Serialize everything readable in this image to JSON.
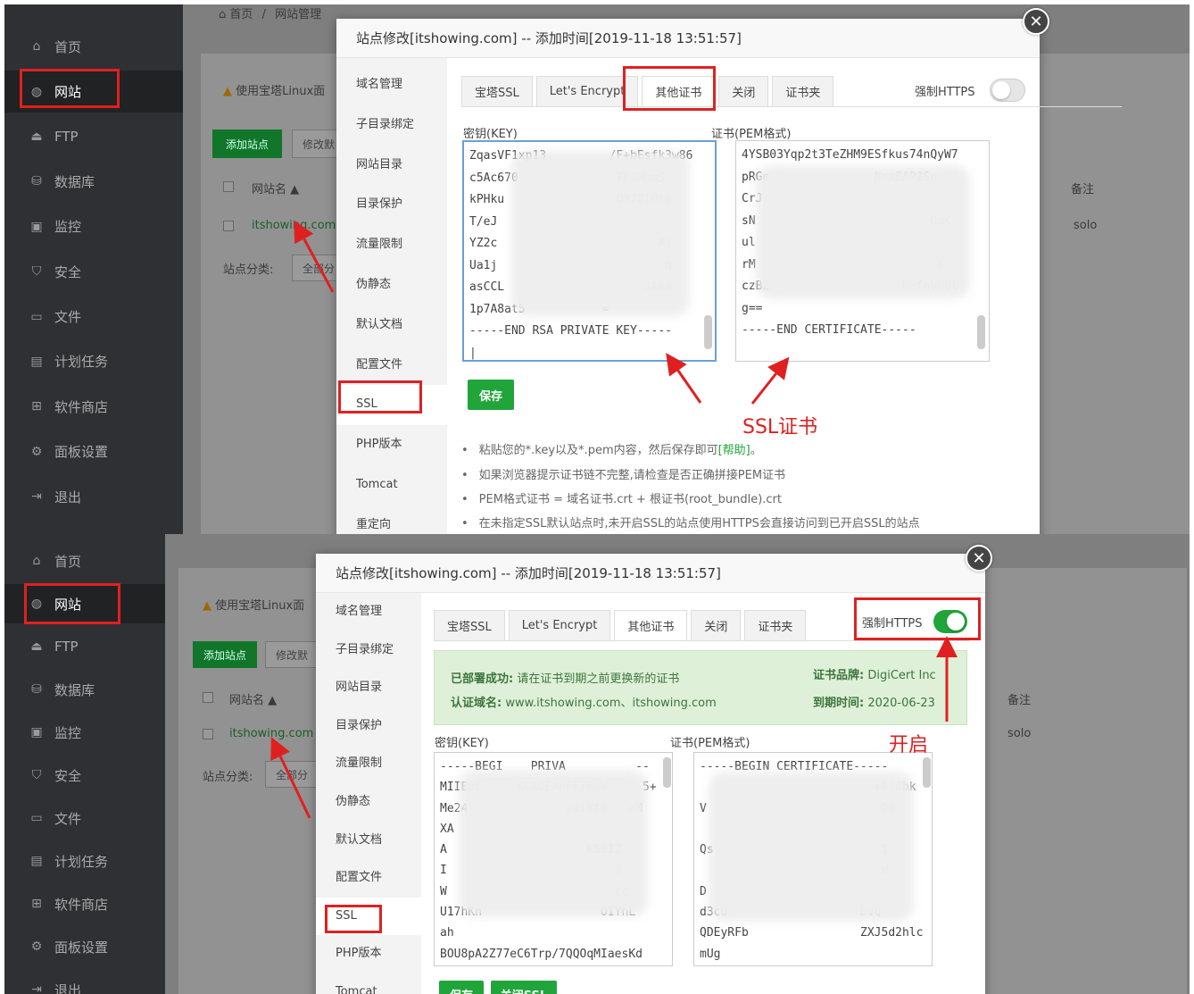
{
  "sidebar": {
    "items": [
      {
        "icon": "home-icon",
        "glyph": "⌂",
        "label": "首页"
      },
      {
        "icon": "globe-icon",
        "glyph": "◍",
        "label": "网站"
      },
      {
        "icon": "ftp-icon",
        "glyph": "⏏",
        "label": "FTP"
      },
      {
        "icon": "database-icon",
        "glyph": "⛁",
        "label": "数据库"
      },
      {
        "icon": "monitor-icon",
        "glyph": "▣",
        "label": "监控"
      },
      {
        "icon": "shield-icon",
        "glyph": "⛉",
        "label": "安全"
      },
      {
        "icon": "folder-icon",
        "glyph": "▭",
        "label": "文件"
      },
      {
        "icon": "calendar-icon",
        "glyph": "▤",
        "label": "计划任务"
      },
      {
        "icon": "grid-icon",
        "glyph": "⊞",
        "label": "软件商店"
      },
      {
        "icon": "gear-icon",
        "glyph": "⚙",
        "label": "面板设置"
      },
      {
        "icon": "logout-icon",
        "glyph": "⇥",
        "label": "退出"
      }
    ]
  },
  "background": {
    "breadcrumb_home": "首页",
    "breadcrumb_sep": "/",
    "breadcrumb_current": "网站管理",
    "notice": "使用宝塔Linux面",
    "warn_glyph": "▲",
    "add_site": "添加站点",
    "modify": "修改默",
    "col_name": "网站名",
    "sort_glyph": "▲",
    "col_remark": "备注",
    "site": "itshowing.com",
    "remark": "solo",
    "category": "站点分类:",
    "category_value": "全部分"
  },
  "modal": {
    "title": "站点修改[itshowing.com] -- 添加时间[2019-11-18 13:51:57]",
    "close_glyph": "✕",
    "nav": [
      "域名管理",
      "子目录绑定",
      "网站目录",
      "目录保护",
      "流量限制",
      "伪静态",
      "默认文档",
      "配置文件",
      "SSL",
      "PHP版本",
      "Tomcat",
      "重定向"
    ],
    "tabs": [
      "宝塔SSL",
      "Let's Encrypt",
      "其他证书",
      "关闭",
      "证书夹"
    ],
    "force_https": "强制HTTPS",
    "key_label": "密钥(KEY)",
    "cert_label": "证书(PEM格式)",
    "save": "保存",
    "close_ssl": "关闭SSL",
    "tips": [
      "粘贴您的*.key以及*.pem内容，然后保存即可",
      "如果浏览器提示证书链不完整,请检查是否正确拼接PEM证书",
      "PEM格式证书 = 域名证书.crt + 根证书(root_bundle).crt",
      "在未指定SSL默认站点时,未开启SSL的站点使用HTTPS会直接访问到已开启SSL的站点"
    ],
    "help_link": "[帮助]",
    "tip_end": "。"
  },
  "screen1": {
    "key_text": "ZqasVF1xp13         /F+bEsfk3w86\nc5Ac670              TK4MhmS\nkPHku                O978lOls\nT/eJ\nYZ2c                       X7\nUa1j                        q\nasCCL                    JARa\n1p7A8at5           =\n-----END RSA PRIVATE KEY-----\n|",
    "cert_text": "4YSB03Yqp2t3TeZHM9ESfkus74nQyW7\npRGe               NmzEAP2Sn\nCrJ\nsN                         QuK\nul\nrM                          l\nczBZ                   0HfnVH8l\ng==\n-----END CERTIFICATE-----",
    "annotation": "SSL证书"
  },
  "screen2": {
    "deployed_label": "已部署成功:",
    "deployed_text": "请在证书到期之前更换新的证书",
    "brand_label": "证书品牌:",
    "brand_value": "DigiCert Inc",
    "domain_label": "认证域名:",
    "domain_value": "www.itshowing.com、itshowing.com",
    "expire_label": "到期时间:",
    "expire_value": "2020-06-23",
    "key_text": "-----BEGI    PRIVA          --\nMIIEpC     KCAQEAnFF/6wW     5+\nMe24              /viVte   aM\nXA\nA                    KSSIZ\nI                        9\nW                        zc\nU17hKn                 OIYhL\nah\nBOU8pA2Z77eC6Trp/7QQOqMIaesKd",
    "cert_text": "-----BEGIN CERTIFICATE-----\n                         +B38bk\nV                         DB\n\nQs                        1\n                          W\nD\nd3cu                   DVQ\nQDEyRFb                ZXJ5d2hlc\nmUg",
    "annotation": "开启"
  },
  "colors": {
    "accent": "#20a53a",
    "annotation": "#e02020",
    "sidebar": "#2f3033"
  }
}
